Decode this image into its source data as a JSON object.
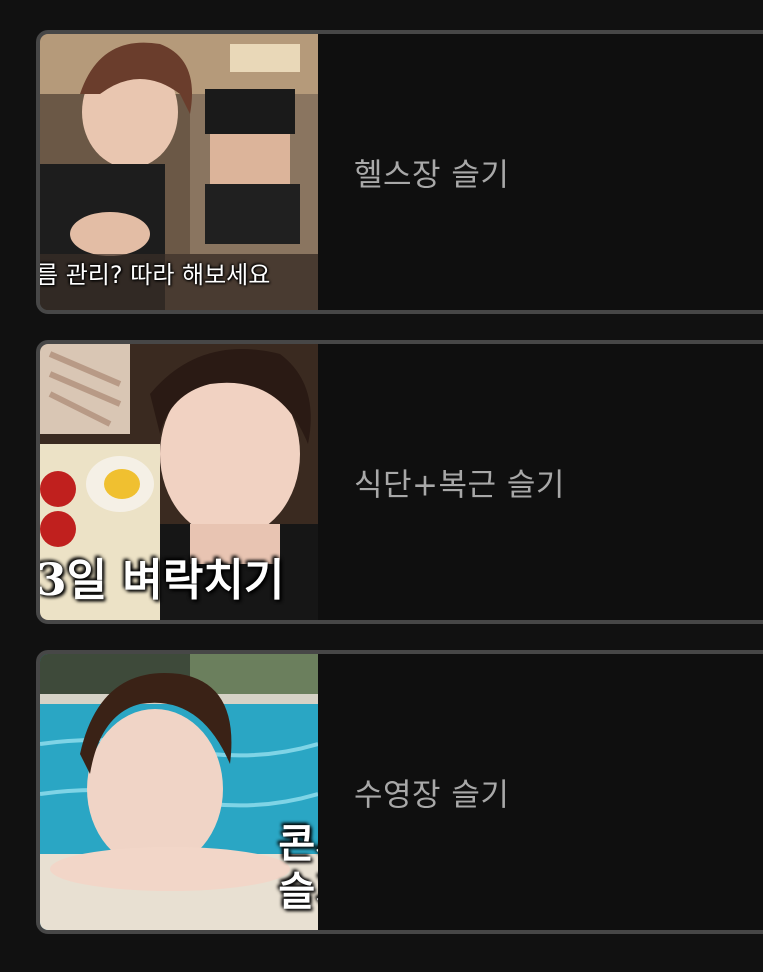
{
  "videos": [
    {
      "title": "헬스장 슬기",
      "thumbnail_caption": "름 관리? 따라 해보세요"
    },
    {
      "title": "식단+복근 슬기",
      "thumbnail_caption": "3일 벼락치기"
    },
    {
      "title": "수영장 슬기",
      "thumbnail_caption_line1": "콘서",
      "thumbnail_caption_line2": "슬기"
    }
  ],
  "colors": {
    "background": "#111111",
    "card_border": "#474747",
    "title_text": "#a8a8a8"
  }
}
